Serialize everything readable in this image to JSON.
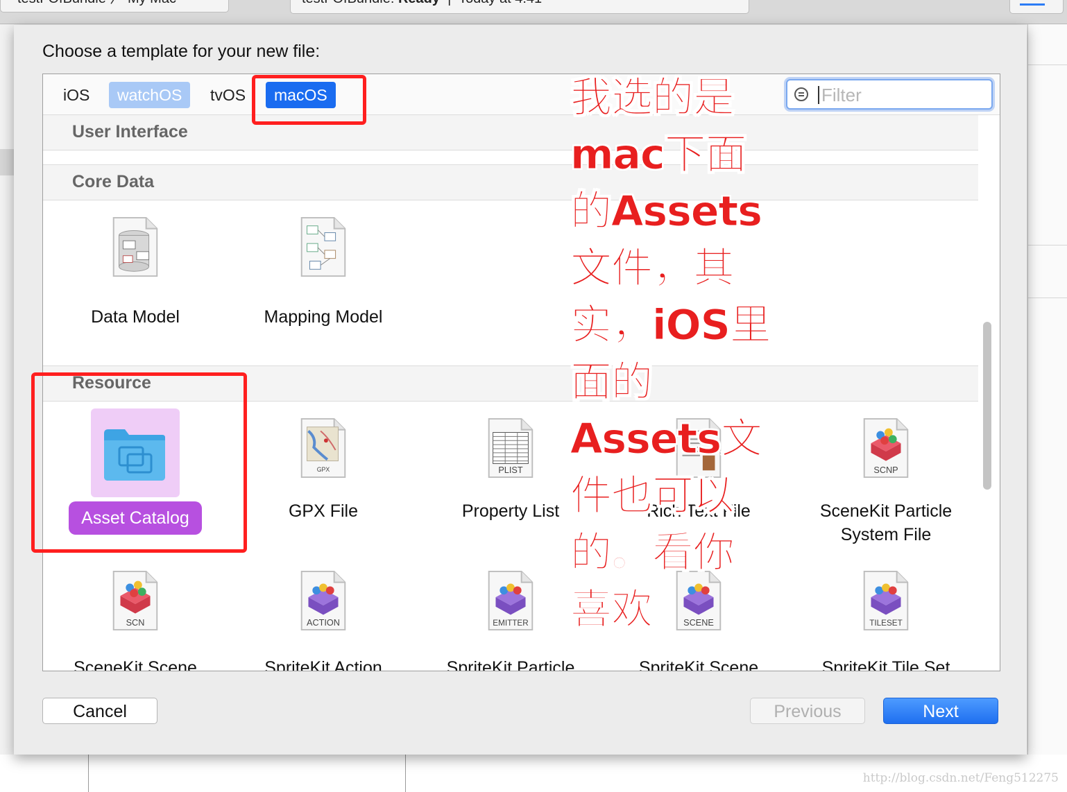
{
  "background": {
    "scheme_text": "testFOfBundle 〉 My Mac",
    "status_project": "testFOfBundle:",
    "status_state": "Ready",
    "status_time": "Today at 4:41",
    "watermark": "http://blog.csdn.net/Feng512275"
  },
  "dialog": {
    "title": "Choose a template for your new file:",
    "tabs": [
      "iOS",
      "watchOS",
      "tvOS",
      "macOS"
    ],
    "selected_tab": "macOS",
    "filter_placeholder": "Filter",
    "sections": {
      "user_interface": "User Interface",
      "core_data": "Core Data",
      "resource": "Resource"
    },
    "core_data_items": [
      {
        "label": "Data Model",
        "icon": "data-model-icon"
      },
      {
        "label": "Mapping Model",
        "icon": "mapping-model-icon"
      }
    ],
    "resource_items": [
      {
        "label": "Asset Catalog",
        "icon": "asset-catalog-folder-icon",
        "selected": true
      },
      {
        "label": "GPX File",
        "icon": "gpx-file-icon",
        "badge": "GPX"
      },
      {
        "label": "Property List",
        "icon": "plist-file-icon",
        "badge": "PLIST"
      },
      {
        "label": "Rich Text File",
        "icon": "rtf-file-icon"
      },
      {
        "label": "SceneKit Particle System File",
        "icon": "scenekit-particle-icon",
        "badge": "SCNP"
      }
    ],
    "bottom_items": [
      {
        "label": "SceneKit Scene",
        "badge": "SCN"
      },
      {
        "label": "SpriteKit Action",
        "badge": "ACTION"
      },
      {
        "label": "SpriteKit Particle",
        "badge": "EMITTER"
      },
      {
        "label": "SpriteKit Scene",
        "badge": "SCENE"
      },
      {
        "label": "SpriteKit Tile Set",
        "badge": "TILESET"
      }
    ],
    "buttons": {
      "cancel": "Cancel",
      "previous": "Previous",
      "next": "Next"
    }
  },
  "annotation": {
    "text": "我选的是\nmac下面\n的Assets\n文件，其\n实，iOS里\n面的\nAssets文\n件也可以\n的。看你\n喜欢",
    "color": "#e81f1f"
  }
}
